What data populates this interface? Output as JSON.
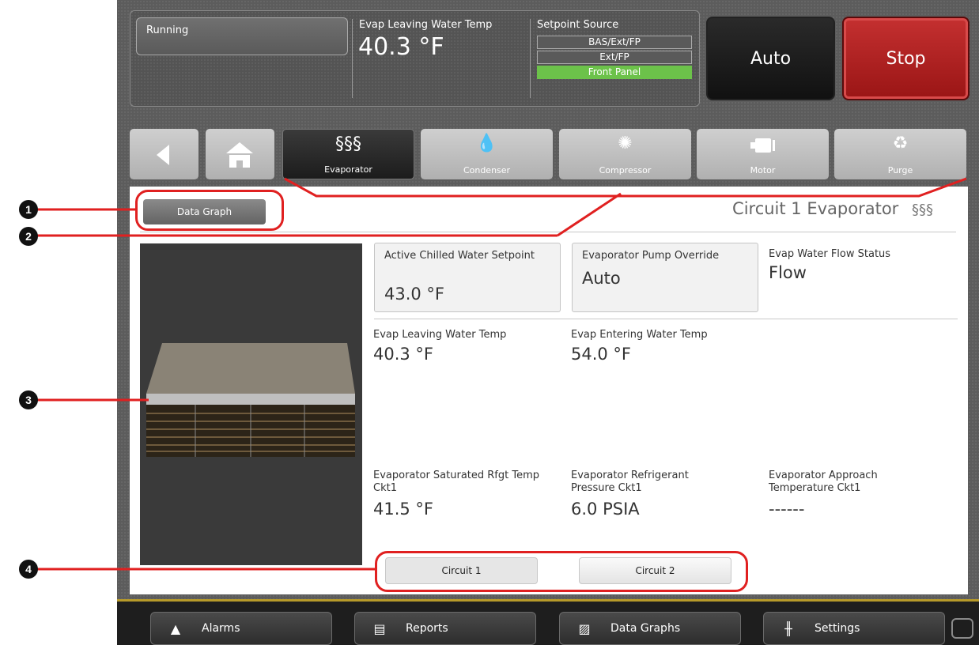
{
  "status": {
    "run_state": "Running",
    "leaving_temp_label": "Evap Leaving Water Temp",
    "leaving_temp_value": "40.3 °F",
    "setpoint_source_label": "Setpoint Source",
    "setpoint_options": [
      "BAS/Ext/FP",
      "Ext/FP",
      "Front Panel"
    ],
    "setpoint_active": "Front Panel",
    "auto_label": "Auto",
    "stop_label": "Stop"
  },
  "tabs": [
    {
      "label": "",
      "icon": "back-arrow-icon"
    },
    {
      "label": "",
      "icon": "home-icon"
    },
    {
      "label": "Evaporator",
      "icon": "heat-waves-icon",
      "active": true
    },
    {
      "label": "Condenser",
      "icon": "droplets-icon"
    },
    {
      "label": "Compressor",
      "icon": "compressor-swirl-icon"
    },
    {
      "label": "Motor",
      "icon": "motor-icon"
    },
    {
      "label": "Purge",
      "icon": "recycle-arrows-icon"
    }
  ],
  "content": {
    "data_graph_button": "Data Graph",
    "title": "Circuit 1 Evaporator",
    "items": {
      "active_chilled_water_setpoint_label": "Active Chilled Water Setpoint",
      "active_chilled_water_setpoint_value": "43.0 °F",
      "evap_pump_override_label": "Evaporator Pump Override",
      "evap_pump_override_value": "Auto",
      "evap_water_flow_label": "Evap Water Flow Status",
      "evap_water_flow_value": "Flow",
      "evap_leaving_label": "Evap Leaving Water Temp",
      "evap_leaving_value": "40.3 °F",
      "evap_entering_label": "Evap Entering Water Temp",
      "evap_entering_value": "54.0 °F",
      "sat_rfgt_label": "Evaporator Saturated Rfgt Temp Ckt1",
      "sat_rfgt_value": "41.5 °F",
      "rfgt_pressure_label": "Evaporator Refrigerant Pressure Ckt1",
      "rfgt_pressure_value": "6.0 PSIA",
      "approach_label": "Evaporator Approach Temperature Ckt1",
      "approach_value": "------"
    },
    "circuit_buttons": [
      "Circuit 1",
      "Circuit 2"
    ],
    "selected_circuit": "Circuit 1"
  },
  "bottom_nav": [
    {
      "label": "Alarms",
      "icon": "bell-icon"
    },
    {
      "label": "Reports",
      "icon": "document-icon"
    },
    {
      "label": "Data Graphs",
      "icon": "chart-icon"
    },
    {
      "label": "Settings",
      "icon": "sliders-icon"
    }
  ],
  "callouts": [
    "1",
    "2",
    "3",
    "4"
  ],
  "colors": {
    "accent_green": "#6cc24a",
    "stop_red": "#b22222",
    "callout_red": "#e02020"
  }
}
